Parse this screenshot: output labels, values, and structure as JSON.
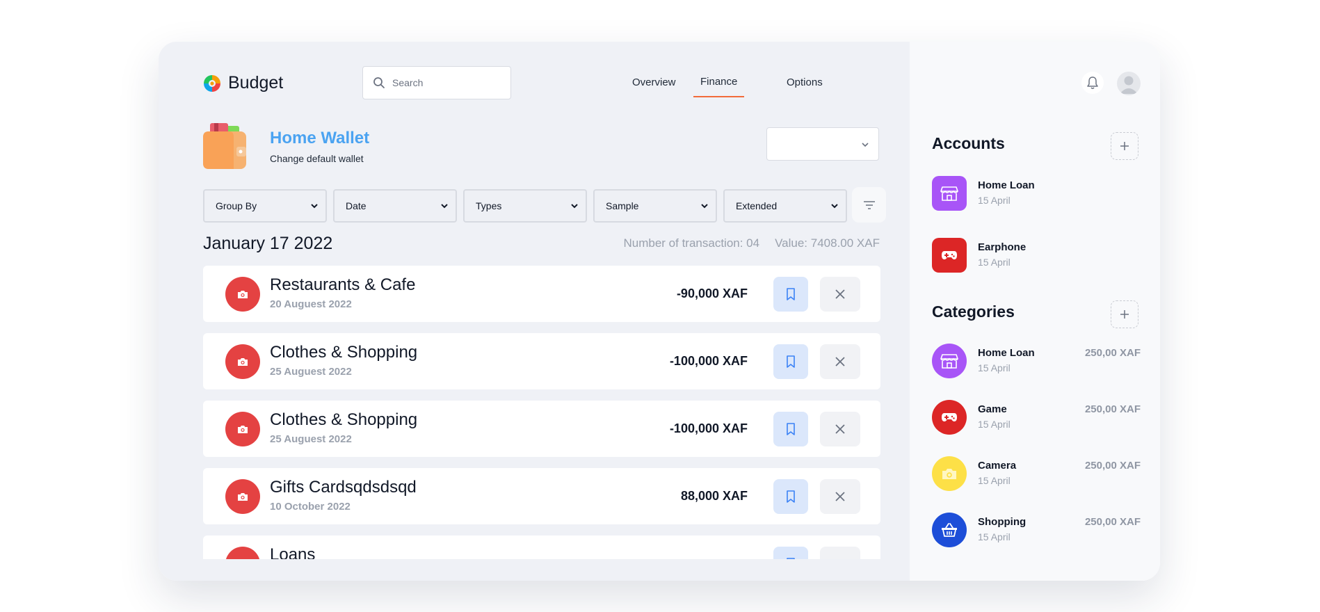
{
  "brand": {
    "name": "Budget"
  },
  "search": {
    "placeholder": "Search"
  },
  "nav": [
    {
      "label": "Overview",
      "active": false
    },
    {
      "label": "Finance",
      "active": true
    },
    {
      "label": "Options",
      "active": false
    }
  ],
  "wallet": {
    "title": "Home Wallet",
    "subtitle": "Change default wallet",
    "select_value": ""
  },
  "filters": [
    {
      "label": "Group By"
    },
    {
      "label": "Date"
    },
    {
      "label": "Types"
    },
    {
      "label": "Sample"
    },
    {
      "label": "Extended"
    }
  ],
  "summary": {
    "date": "January 17 2022",
    "transactions": "Number of transaction: 04",
    "value": "Value: 7408.00 XAF"
  },
  "transactions": [
    {
      "name": "Restaurants & Cafe",
      "date": "20 Auguest 2022",
      "amount": "-90,000 XAF",
      "icon": "camera-icon"
    },
    {
      "name": "Clothes & Shopping",
      "date": "25 Auguest 2022",
      "amount": "-100,000 XAF",
      "icon": "camera-icon"
    },
    {
      "name": "Clothes & Shopping",
      "date": "25 Auguest 2022",
      "amount": "-100,000 XAF",
      "icon": "camera-icon"
    },
    {
      "name": "Gifts Cardsqdsdsqd",
      "date": "10 October 2022",
      "amount": "88,000 XAF",
      "icon": "camera-icon"
    },
    {
      "name": "Loans",
      "date": "",
      "amount": "",
      "icon": "camera-icon"
    }
  ],
  "accounts": {
    "title": "Accounts",
    "items": [
      {
        "name": "Home Loan",
        "date": "15 April",
        "icon": "store-icon",
        "color": "#a855f7"
      },
      {
        "name": "Earphone",
        "date": "15 April",
        "icon": "gamepad-icon",
        "color": "#dc2626"
      }
    ]
  },
  "categories": {
    "title": "Categories",
    "items": [
      {
        "name": "Home Loan",
        "date": "15 April",
        "amount": "250,00 XAF",
        "icon": "store-icon",
        "color": "#a855f7"
      },
      {
        "name": "Game",
        "date": "15 April",
        "amount": "250,00 XAF",
        "icon": "gamepad-icon",
        "color": "#dc2626"
      },
      {
        "name": "Camera",
        "date": "15 April",
        "amount": "250,00 XAF",
        "icon": "camera-icon",
        "color": "#fde047"
      },
      {
        "name": "Shopping",
        "date": "15 April",
        "amount": "250,00 XAF",
        "icon": "basket-icon",
        "color": "#1d4ed8"
      }
    ]
  },
  "colors": {
    "accent": "#f26b3a",
    "wallet_title": "#4ba3f1",
    "transaction_icon_bg": "#e44242",
    "save_button_bg": "#dbe7fb"
  }
}
